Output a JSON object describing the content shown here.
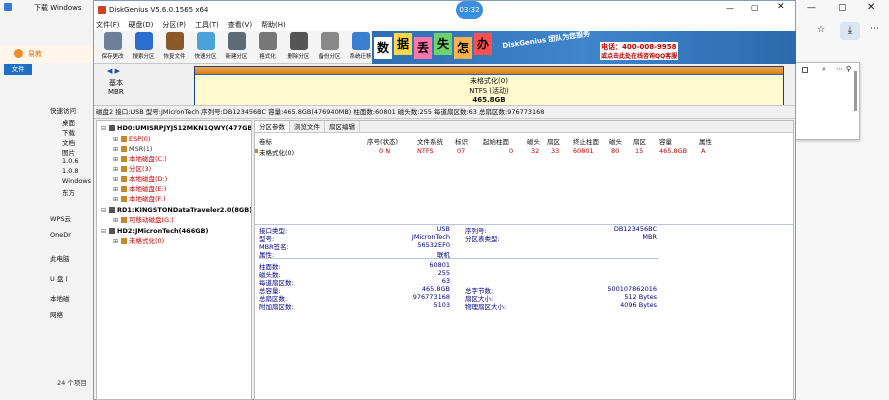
{
  "explorer": {
    "title": "下载 Windows",
    "sidebar": [
      "快速访问",
      "桌面",
      "下载",
      "文档",
      "图片",
      "1.0.6",
      "1.0.8",
      "Windows",
      "东方",
      "WPS云",
      "OneDr",
      "此电脑",
      "U 盘 (",
      "本地磁",
      "网络"
    ],
    "count": "24 个项目"
  },
  "browser": {
    "tab": "易教"
  },
  "window": {
    "title": "DiskGenius V5.6.0.1565 x64",
    "clock": "03:32",
    "menu": [
      "文件(F)",
      "硬盘(D)",
      "分区(P)",
      "工具(T)",
      "查看(V)",
      "帮助(H)"
    ],
    "toolbar": [
      "保存更改",
      "搜索分区",
      "恢复文件",
      "快速分区",
      "新建分区",
      "格式化",
      "删除分区",
      "备份分区",
      "系统迁移"
    ],
    "banner": {
      "tiles": [
        "数",
        "据",
        "丢",
        "失",
        "怎",
        "办"
      ],
      "slogan": "DiskGenius 团队为您服务",
      "phone": "电话：400-008-9958",
      "qq": "或点击此处在线咨询QQ客服"
    }
  },
  "diskbar": {
    "mode": "基本",
    "type": "MBR",
    "part_name": "未格式化(0)",
    "part_fs": "NTFS (活动)",
    "part_size": "465.8GB"
  },
  "infoline": "磁盘2 接口:USB 型号:JMicronTech 序列号:DB123456BC 容量:465.8GB(476940MB) 柱面数:60801 磁头数:255 每道扇区数:63 总扇区数:976773168",
  "tree": [
    {
      "text": "HD0:UMISRPJYJ512MKN1QWY(477GB)",
      "bold": true,
      "indent": 0,
      "color": "#000"
    },
    {
      "text": "ESP(0)",
      "indent": 1,
      "color": "#c00000"
    },
    {
      "text": "MSR(1)",
      "indent": 1,
      "color": "#333"
    },
    {
      "text": "本地磁盘(C:)",
      "indent": 1,
      "color": "#c00000"
    },
    {
      "text": "分区(3)",
      "indent": 1,
      "color": "#c00000"
    },
    {
      "text": "本地磁盘(D:)",
      "indent": 1,
      "color": "#c00000"
    },
    {
      "text": "本地磁盘(E:)",
      "indent": 1,
      "color": "#c00000"
    },
    {
      "text": "本地磁盘(F:)",
      "indent": 1,
      "color": "#c00000"
    },
    {
      "text": "RD1:KINGSTONDataTraveler2.0(8GB)",
      "bold": true,
      "indent": 0,
      "color": "#000"
    },
    {
      "text": "可移动磁盘(G:)",
      "indent": 1,
      "color": "#c00000"
    },
    {
      "text": "HD2:JMicronTech(466GB)",
      "bold": true,
      "indent": 0,
      "color": "#000"
    },
    {
      "text": "未格式化(0)",
      "indent": 1,
      "color": "#c00000"
    }
  ],
  "tabs": [
    "分区参数",
    "浏览文件",
    "扇区编辑"
  ],
  "table": {
    "headers": [
      "卷标",
      "序号(状态)",
      "文件系统",
      "标识",
      "起始柱面",
      "磁头",
      "扇区",
      "终止柱面",
      "磁头",
      "扇区",
      "容量",
      "属性"
    ],
    "row": [
      "未格式化(0)",
      "0 N",
      "NTFS",
      "07",
      "0",
      "32",
      "33",
      "60801",
      "80",
      "15",
      "465.8GB",
      "A"
    ]
  },
  "details": {
    "interface_label": "接口类型:",
    "interface": "USB",
    "model_label": "型号:",
    "model": "JMicronTech",
    "mbr_label": "MBR签名:",
    "mbr": "56532EF0",
    "attr_label": "属性:",
    "attr": "联机",
    "serial_label": "序列号:",
    "serial": "DB123456BC",
    "pt_label": "分区表类型:",
    "pt": "MBR",
    "cyl_label": "柱面数:",
    "cyl": "60801",
    "heads_label": "磁头数:",
    "heads": "255",
    "spt_label": "每道扇区数:",
    "spt": "63",
    "cap_label": "总容量:",
    "cap": "465.8GB",
    "total_label": "总扇区数:",
    "total": "976773168",
    "extra_label": "附加扇区数:",
    "extra": "5103",
    "bytes_label": "总字节数:",
    "bytes": "500107862016",
    "sector_label": "扇区大小:",
    "sector": "512 Bytes",
    "phys_label": "物理扇区大小:",
    "phys": "4096 Bytes"
  }
}
